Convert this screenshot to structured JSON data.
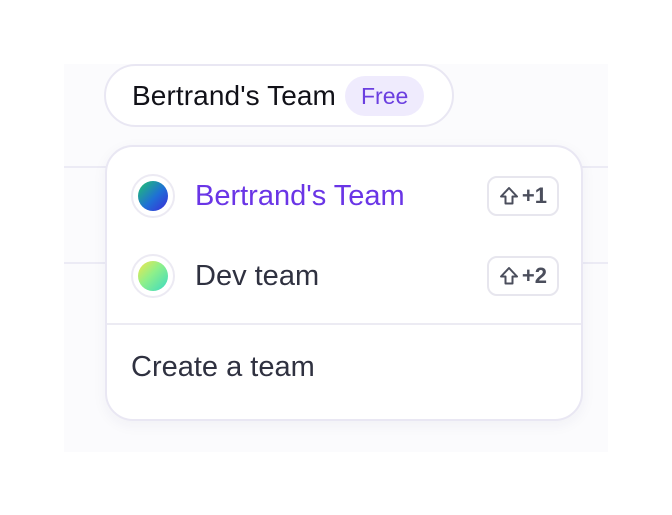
{
  "team_selector": {
    "current_team": "Bertrand's Team",
    "plan_badge": "Free"
  },
  "dropdown": {
    "teams": [
      {
        "name": "Bertrand's Team",
        "shortcut": "+1",
        "shortcut_icon": "shift-icon",
        "active": true,
        "avatar_gradient": [
          "#21c56b",
          "#1f6fd6",
          "#3b2ad8"
        ]
      },
      {
        "name": "Dev team",
        "shortcut": "+2",
        "shortcut_icon": "shift-icon",
        "active": false,
        "avatar_gradient": [
          "#f2e64a",
          "#8ef08a",
          "#3ad9c3"
        ]
      }
    ],
    "create_label": "Create a team"
  },
  "colors": {
    "accent": "#6a35e6",
    "badge_bg": "#efebfd",
    "text": "#2f3140",
    "border": "#e9e7f3"
  }
}
